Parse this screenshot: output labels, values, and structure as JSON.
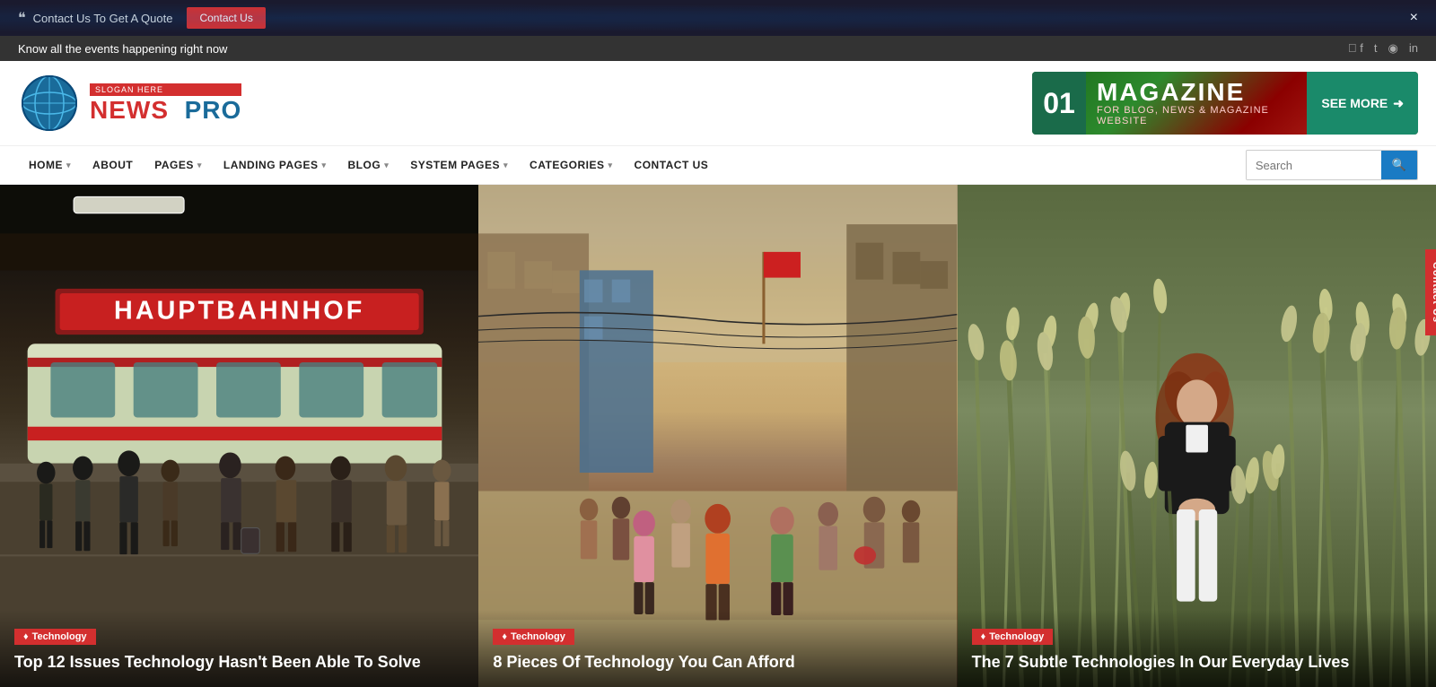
{
  "topBar": {
    "quoteText": "Contact Us To Get A Quote",
    "ctaLabel": "Contact Us",
    "closeLabel": "×"
  },
  "ticker": {
    "text": "Know all the events happening right now",
    "socials": [
      "f",
      "t",
      "p",
      "in"
    ]
  },
  "header": {
    "logoSlogan": "SLOGAN HERE",
    "logoName1": "NEWS",
    "logoName2": "PRO",
    "banner": {
      "number": "01",
      "title": "MAGAZINE",
      "subtitle": "FOR BLOG, NEWS & MAGAZINE WEBSITE",
      "cta": "SEE MORE"
    }
  },
  "nav": {
    "items": [
      {
        "label": "HOME",
        "hasDropdown": true
      },
      {
        "label": "ABOUT",
        "hasDropdown": false
      },
      {
        "label": "PAGES",
        "hasDropdown": true
      },
      {
        "label": "LANDING PAGES",
        "hasDropdown": true
      },
      {
        "label": "BLOG",
        "hasDropdown": true
      },
      {
        "label": "SYSTEM PAGES",
        "hasDropdown": true
      },
      {
        "label": "CATEGORIES",
        "hasDropdown": true
      },
      {
        "label": "CONTACT US",
        "hasDropdown": false
      }
    ],
    "searchPlaceholder": "Search"
  },
  "contactTab": "Contact Us",
  "heroItems": [
    {
      "tag": "Technology",
      "title": "Top 12 Issues Technology Hasn't Been Able To Solve",
      "bgColor": "#2a2010",
      "bgGradient": "linear-gradient(180deg, #1a1208 0%, #2a2010 30%, #3a3018 50%, #2a2510 70%, #1a1a0a 100%)"
    },
    {
      "tag": "Technology",
      "title": "8 Pieces Of Technology You Can Afford",
      "bgColor": "#c4a870",
      "bgGradient": "linear-gradient(180deg, #a09070 0%, #b0a080 20%, #c8b890 40%, #b4a478 60%, #806040 80%, #4a3820 100%)"
    },
    {
      "tag": "Technology",
      "title": "The 7 Subtle Technologies In Our Everyday Lives",
      "bgColor": "#4a5a30",
      "bgGradient": "linear-gradient(180deg, #2a4a18 0%, #3a5a28 20%, #5a7a40 40%, #6a8a50 60%, #4a6a38 80%, #2a4a20 100%)"
    }
  ]
}
